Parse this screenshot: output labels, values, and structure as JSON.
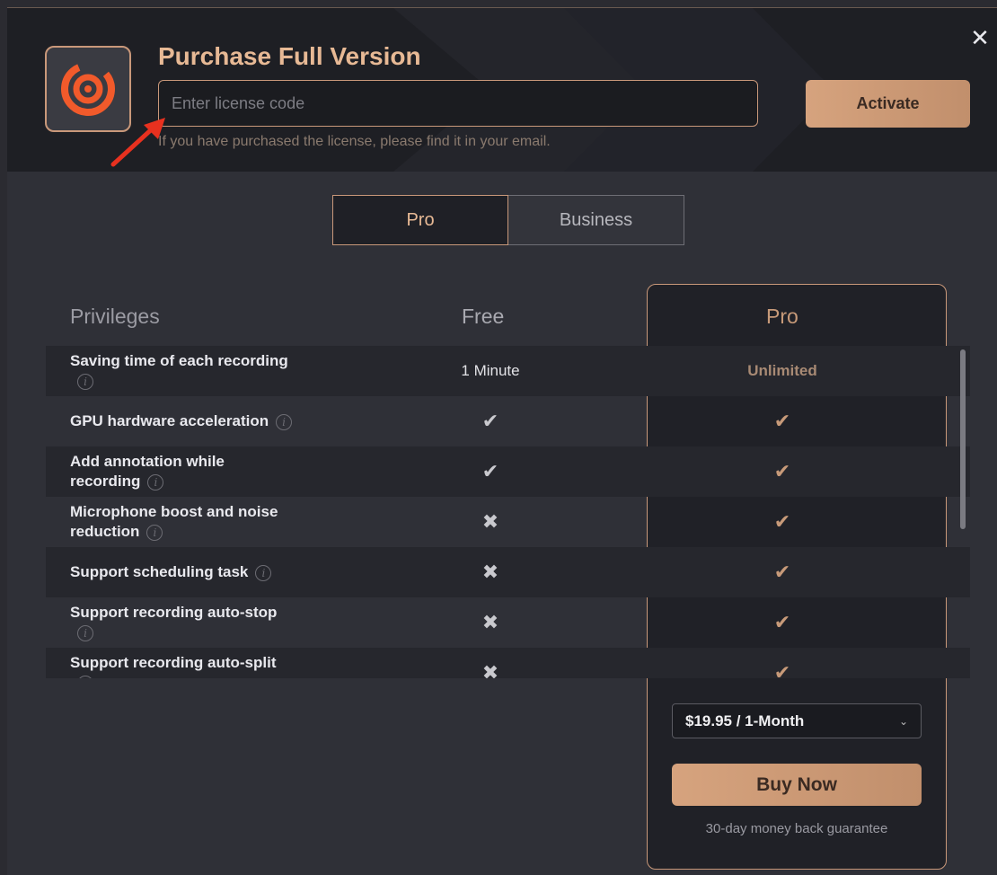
{
  "header": {
    "title": "Purchase Full Version",
    "license_placeholder": "Enter license code",
    "hint": "If you have purchased the license, please find it in your email.",
    "activate_label": "Activate",
    "close_glyph": "✕"
  },
  "tabs": [
    {
      "label": "Pro",
      "active": true
    },
    {
      "label": "Business",
      "active": false
    }
  ],
  "table": {
    "headers": {
      "privileges": "Privileges",
      "free": "Free",
      "pro": "Pro"
    },
    "rows": [
      {
        "feature": "Saving time of each recording",
        "free": "1 Minute",
        "pro": "Unlimited"
      },
      {
        "feature": "GPU hardware acceleration",
        "free": "check",
        "pro": "check"
      },
      {
        "feature": "Add annotation while recording",
        "free": "check",
        "pro": "check"
      },
      {
        "feature": "Microphone boost and noise reduction",
        "free": "cross",
        "pro": "check"
      },
      {
        "feature": "Support scheduling task",
        "free": "cross",
        "pro": "check"
      },
      {
        "feature": "Support recording auto-stop",
        "free": "cross",
        "pro": "check"
      },
      {
        "feature": "Support recording auto-split",
        "free": "cross",
        "pro": "check"
      }
    ]
  },
  "purchase": {
    "plan_selected": "$19.95 / 1-Month",
    "buy_label": "Buy Now",
    "guarantee": "30-day money back guarantee"
  },
  "icons": {
    "info": "i",
    "check": "✔",
    "cross": "✖",
    "chevron": "⌄"
  },
  "colors": {
    "accent": "#c9987a",
    "title": "#e7b995",
    "logo_orange": "#f15a2b"
  }
}
